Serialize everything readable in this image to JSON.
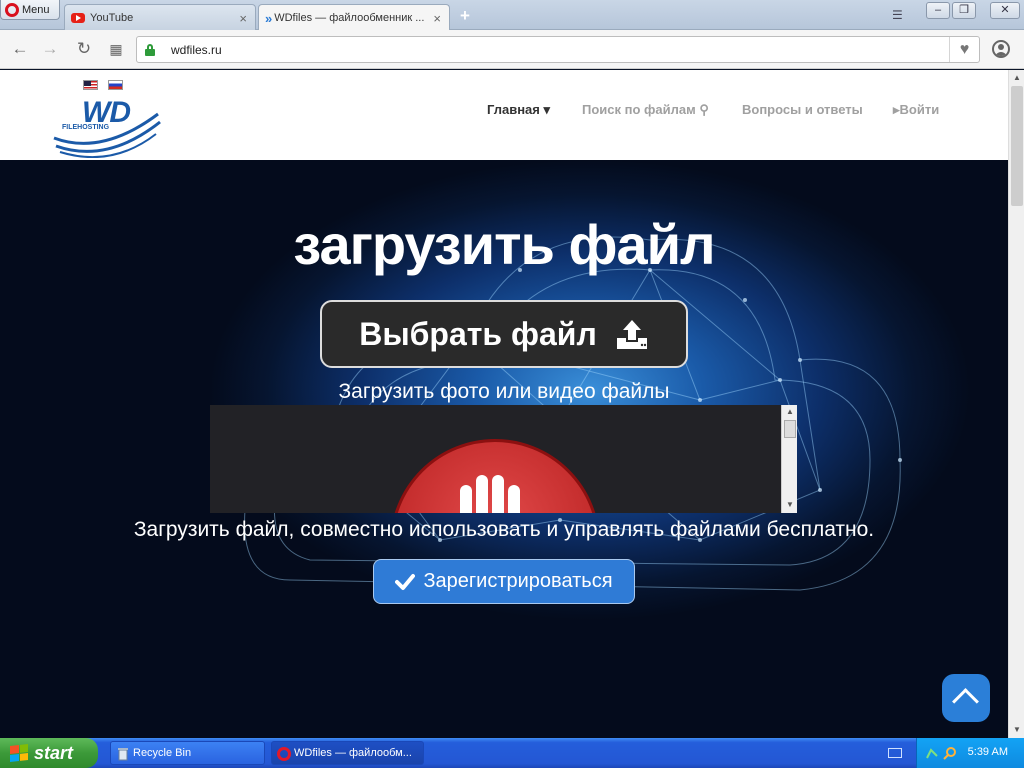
{
  "browser": {
    "menu_label": "Menu",
    "tabs": [
      {
        "label": "YouTube",
        "icon": "youtube-icon",
        "active": false
      },
      {
        "label": "WDfiles — файлообменник ...",
        "icon": "wdfiles-icon",
        "active": true
      }
    ],
    "address": "wdfiles.ru"
  },
  "site": {
    "logo_text": "WD",
    "logo_sub": "FILEHOSTING",
    "nav": [
      {
        "label": "Главная ▾",
        "active": true
      },
      {
        "label": "Поиск по файлам",
        "active": false
      },
      {
        "label": "Вопросы и ответы",
        "active": false
      },
      {
        "label": "Войти",
        "active": false
      }
    ]
  },
  "hero": {
    "title": "загрузить файл",
    "choose_button": "Выбрать файл",
    "subtitle": "Загрузить фото или видео файлы",
    "description": "Загрузить файл, совместно использовать и управлять файлами бесплатно.",
    "register_button": "Зарегистрироваться"
  },
  "taskbar": {
    "start_label": "start",
    "items": [
      {
        "label": "Recycle Bin",
        "icon": "recycle-bin-icon"
      },
      {
        "label": "WDfiles — файлообм...",
        "icon": "opera-icon"
      }
    ],
    "clock": "5:39 AM"
  },
  "colors": {
    "accent": "#2b7fd8",
    "brand": "#1b5aa8",
    "taskbar": "#245edb",
    "start_green": "#3c9a39"
  }
}
